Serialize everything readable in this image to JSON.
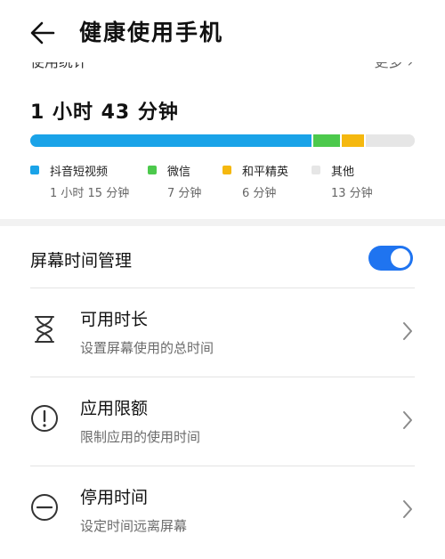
{
  "header": {
    "title": "健康使用手机"
  },
  "usage": {
    "clipped_label": "使用统计",
    "clipped_more": "更多 ›",
    "total": "1 小时 43 分钟",
    "apps": [
      {
        "name": "抖音短视频",
        "duration": "1 小时 15 分钟",
        "minutes": 75,
        "color": "#1aa3e8"
      },
      {
        "name": "微信",
        "duration": "7 分钟",
        "minutes": 7,
        "color": "#4cc94c"
      },
      {
        "name": "和平精英",
        "duration": "6 分钟",
        "minutes": 6,
        "color": "#f5b80f"
      },
      {
        "name": "其他",
        "duration": "13 分钟",
        "minutes": 13,
        "color": "#e6e6e6"
      }
    ]
  },
  "manage": {
    "title": "屏幕时间管理",
    "enabled": true,
    "accent_color": "#1f74f0",
    "items": [
      {
        "icon": "hourglass-icon",
        "label": "可用时长",
        "desc": "设置屏幕使用的总时间"
      },
      {
        "icon": "alert-circle-icon",
        "label": "应用限额",
        "desc": "限制应用的使用时间"
      },
      {
        "icon": "minus-circle-icon",
        "label": "停用时间",
        "desc": "设定时间远离屏幕"
      }
    ]
  }
}
